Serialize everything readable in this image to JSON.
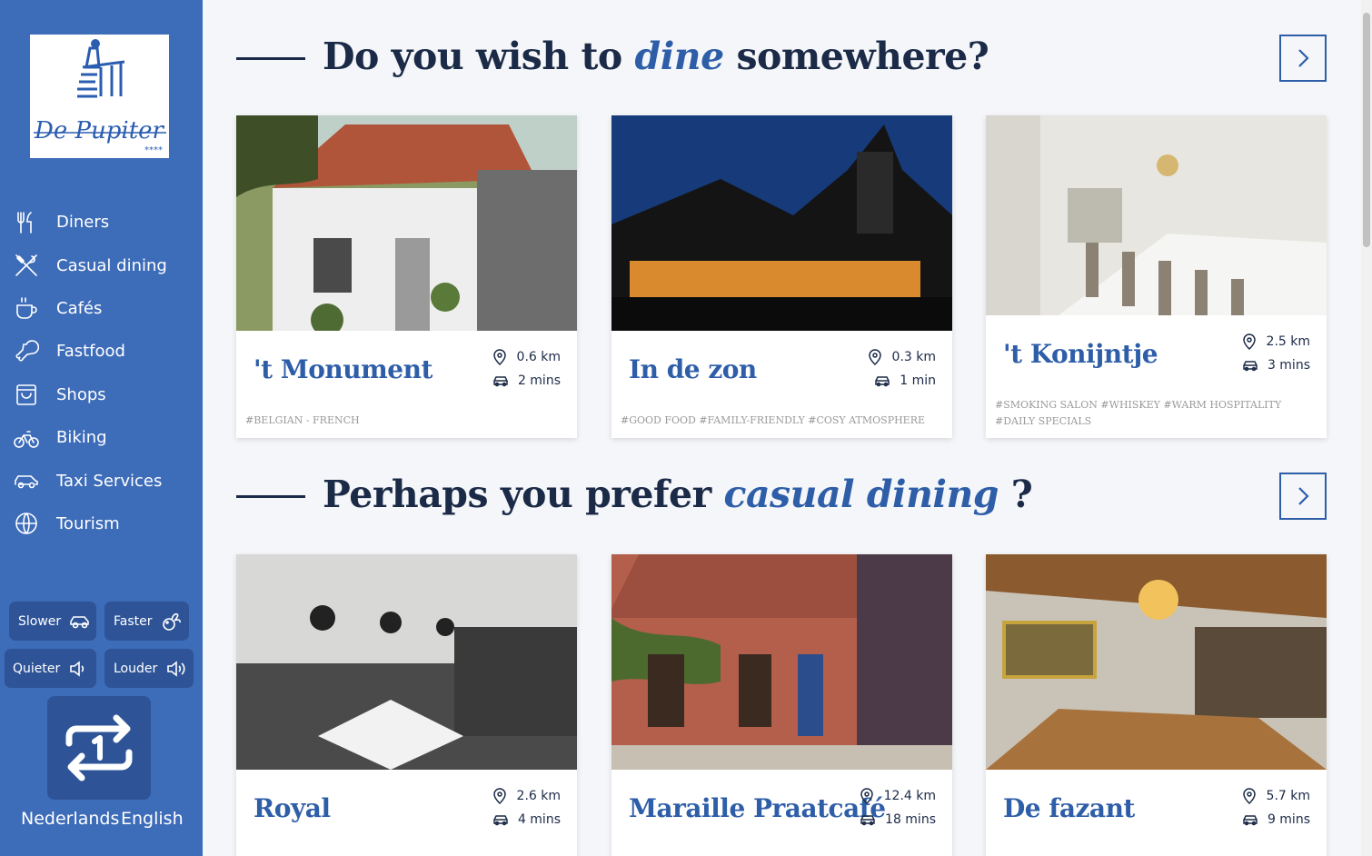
{
  "logo": {
    "text": "De Pupiter",
    "stars": "****"
  },
  "nav": [
    {
      "label": "Diners",
      "icon": "fork-knife-icon"
    },
    {
      "label": "Casual dining",
      "icon": "crossed-utensils-icon"
    },
    {
      "label": "Cafés",
      "icon": "coffee-cup-icon"
    },
    {
      "label": "Fastfood",
      "icon": "drumstick-icon"
    },
    {
      "label": "Shops",
      "icon": "shopping-bag-icon"
    },
    {
      "label": "Biking",
      "icon": "bicycle-icon"
    },
    {
      "label": "Taxi Services",
      "icon": "taxi-icon"
    },
    {
      "label": "Tourism",
      "icon": "globe-icon"
    }
  ],
  "controls": {
    "slower": "Slower",
    "faster": "Faster",
    "quieter": "Quieter",
    "louder": "Louder"
  },
  "languages": {
    "nl": "Nederlands",
    "en": "English"
  },
  "sections": [
    {
      "title_pre": "Do you wish to ",
      "title_em": "dine",
      "title_post": " somewhere?",
      "cards": [
        {
          "name": "'t Monument",
          "distance": "0.6 km",
          "time": "2 mins",
          "tags": "#BELGIAN - FRENCH"
        },
        {
          "name": "In de zon",
          "distance": "0.3 km",
          "time": "1 min",
          "tags": "#GOOD FOOD  #FAMILY-FRIENDLY  #COSY ATMOSPHERE"
        },
        {
          "name": "'t Konijntje",
          "distance": "2.5 km",
          "time": "3 mins",
          "tags": "#SMOKING SALON  #WHISKEY  #WARM HOSPITALITY  #DAILY SPECIALS"
        }
      ]
    },
    {
      "title_pre": "Perhaps you prefer ",
      "title_em": "casual dining",
      "title_post": " ?",
      "cards": [
        {
          "name": "Royal",
          "distance": "2.6 km",
          "time": "4 mins",
          "tags": ""
        },
        {
          "name": "Maraille Praatcafé",
          "distance": "12.4 km",
          "time": "18 mins",
          "tags": ""
        },
        {
          "name": "De fazant",
          "distance": "5.7 km",
          "time": "9 mins",
          "tags": ""
        }
      ]
    }
  ],
  "colors": {
    "sidebar": "#3d6cb9",
    "button_dark": "#2e5497",
    "heading": "#1b2a47",
    "accent": "#2e5ea8"
  }
}
